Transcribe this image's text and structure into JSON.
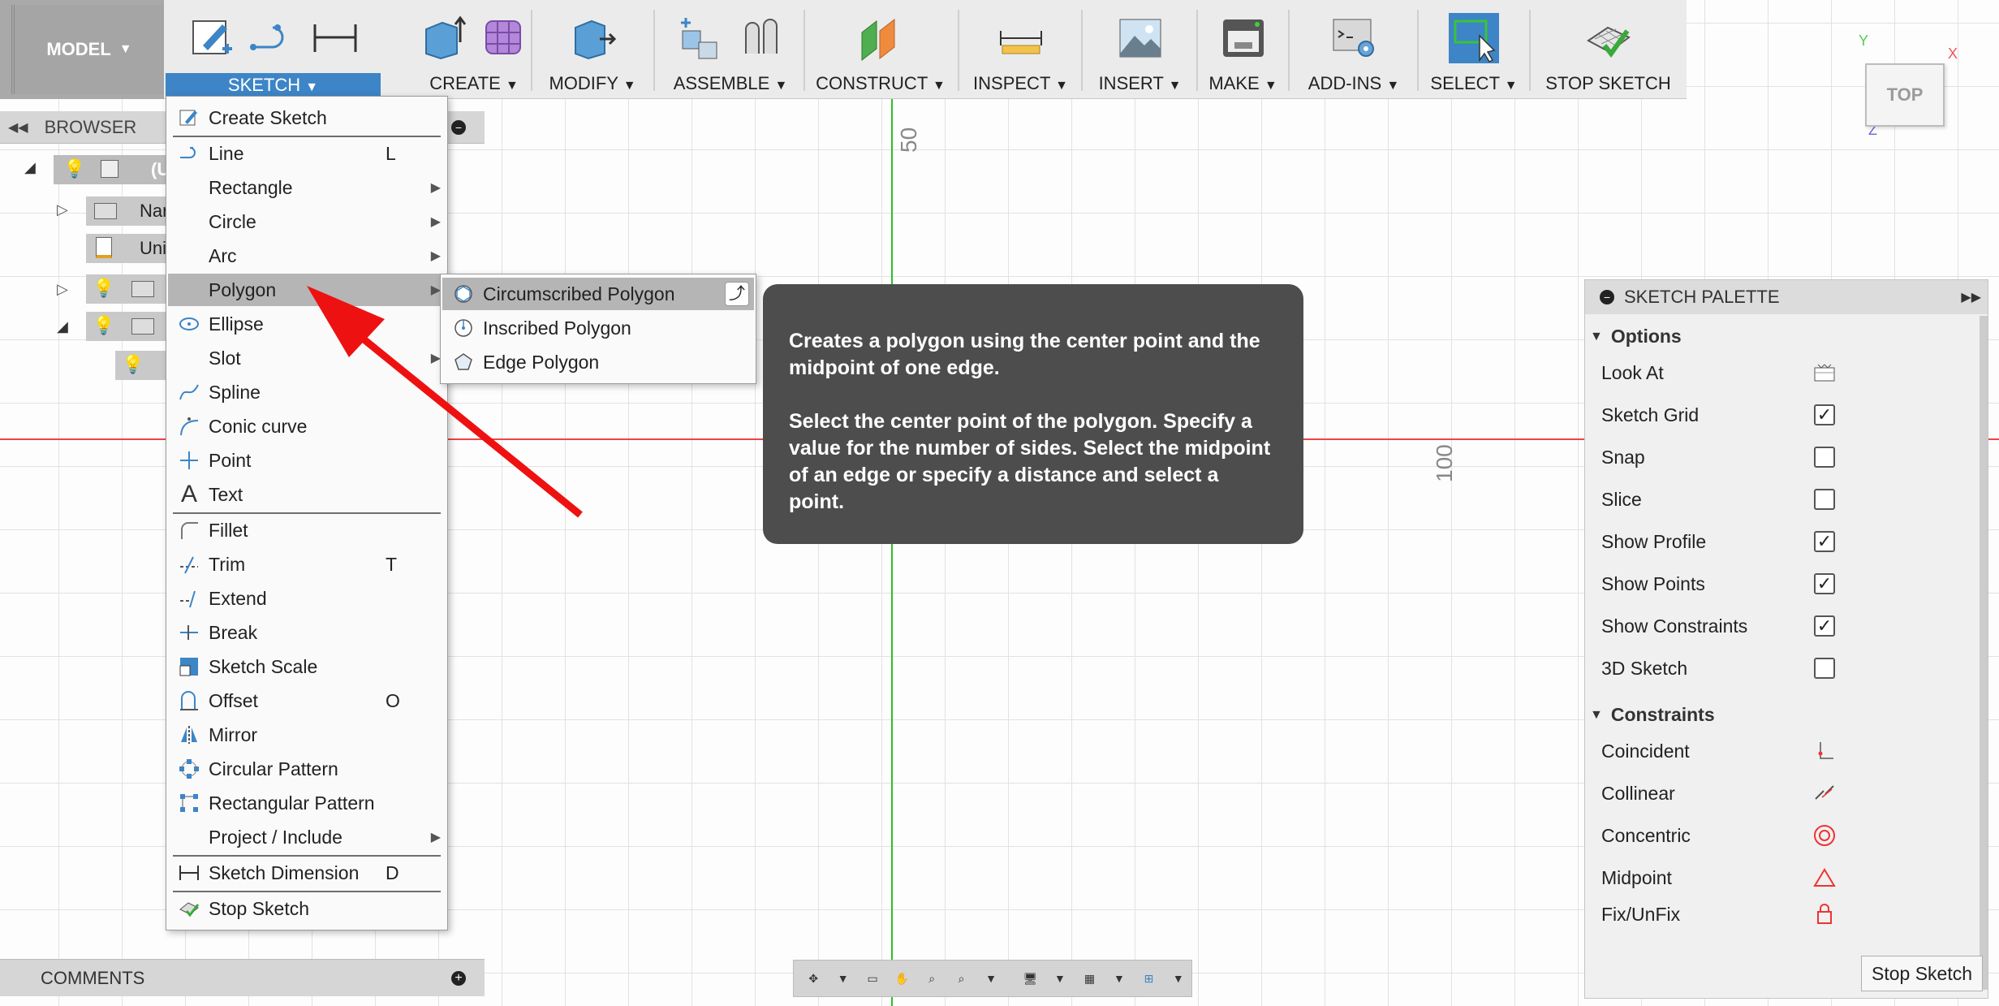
{
  "toolbar": {
    "model_label": "MODEL",
    "groups": {
      "sketch": "SKETCH",
      "create": "CREATE",
      "modify": "MODIFY",
      "assemble": "ASSEMBLE",
      "construct": "CONSTRUCT",
      "inspect": "INSPECT",
      "insert": "INSERT",
      "make": "MAKE",
      "addins": "ADD-INS",
      "select": "SELECT",
      "stop_sketch": "STOP SKETCH"
    }
  },
  "browser": {
    "title": "BROWSER",
    "rows": [
      "(U",
      "Nar",
      "Uni"
    ]
  },
  "comments": {
    "title": "COMMENTS"
  },
  "canvas": {
    "label_50": "50",
    "label_100": "100"
  },
  "viewcube": {
    "face": "TOP",
    "x": "X",
    "y": "Y",
    "z": "Z"
  },
  "sketch_menu": {
    "items": [
      {
        "label": "Create Sketch",
        "shortcut": "",
        "submenu": false
      },
      {
        "label": "Line",
        "shortcut": "L",
        "submenu": false
      },
      {
        "label": "Rectangle",
        "shortcut": "",
        "submenu": true
      },
      {
        "label": "Circle",
        "shortcut": "",
        "submenu": true
      },
      {
        "label": "Arc",
        "shortcut": "",
        "submenu": true
      },
      {
        "label": "Polygon",
        "shortcut": "",
        "submenu": true
      },
      {
        "label": "Ellipse",
        "shortcut": "",
        "submenu": false
      },
      {
        "label": "Slot",
        "shortcut": "",
        "submenu": true
      },
      {
        "label": "Spline",
        "shortcut": "",
        "submenu": false
      },
      {
        "label": "Conic curve",
        "shortcut": "",
        "submenu": false
      },
      {
        "label": "Point",
        "shortcut": "",
        "submenu": false
      },
      {
        "label": "Text",
        "shortcut": "",
        "submenu": false
      },
      {
        "label": "Fillet",
        "shortcut": "",
        "submenu": false
      },
      {
        "label": "Trim",
        "shortcut": "T",
        "submenu": false
      },
      {
        "label": "Extend",
        "shortcut": "",
        "submenu": false
      },
      {
        "label": "Break",
        "shortcut": "",
        "submenu": false
      },
      {
        "label": "Sketch Scale",
        "shortcut": "",
        "submenu": false
      },
      {
        "label": "Offset",
        "shortcut": "O",
        "submenu": false
      },
      {
        "label": "Mirror",
        "shortcut": "",
        "submenu": false
      },
      {
        "label": "Circular Pattern",
        "shortcut": "",
        "submenu": false
      },
      {
        "label": "Rectangular Pattern",
        "shortcut": "",
        "submenu": false
      },
      {
        "label": "Project / Include",
        "shortcut": "",
        "submenu": true
      },
      {
        "label": "Sketch Dimension",
        "shortcut": "D",
        "submenu": false
      },
      {
        "label": "Stop Sketch",
        "shortcut": "",
        "submenu": false
      }
    ],
    "highlighted": "Polygon"
  },
  "polygon_submenu": {
    "items": [
      "Circumscribed Polygon",
      "Inscribed Polygon",
      "Edge Polygon"
    ],
    "highlighted": "Circumscribed Polygon"
  },
  "tooltip": {
    "line1": "Creates a polygon using the center point and the midpoint of one edge.",
    "line2": "Select the center point of the polygon. Specify a value for the number of sides. Select the midpoint of an edge or specify a distance and select a point."
  },
  "palette": {
    "title": "SKETCH PALETTE",
    "options_title": "Options",
    "options": [
      {
        "label": "Look At",
        "type": "button"
      },
      {
        "label": "Sketch Grid",
        "type": "checkbox",
        "checked": true
      },
      {
        "label": "Snap",
        "type": "checkbox",
        "checked": false
      },
      {
        "label": "Slice",
        "type": "checkbox",
        "checked": false
      },
      {
        "label": "Show Profile",
        "type": "checkbox",
        "checked": true
      },
      {
        "label": "Show Points",
        "type": "checkbox",
        "checked": true
      },
      {
        "label": "Show Constraints",
        "type": "checkbox",
        "checked": true
      },
      {
        "label": "3D Sketch",
        "type": "checkbox",
        "checked": false
      }
    ],
    "constraints_title": "Constraints",
    "constraints": [
      "Coincident",
      "Collinear",
      "Concentric",
      "Midpoint",
      "Fix/UnFix"
    ],
    "stop_button": "Stop Sketch"
  },
  "colors": {
    "accent": "#3d85c6",
    "arrow": "#ee1111",
    "tooltip_bg": "#4d4d4d",
    "x_axis": "#ee4444",
    "y_axis": "#2bbf2b"
  }
}
